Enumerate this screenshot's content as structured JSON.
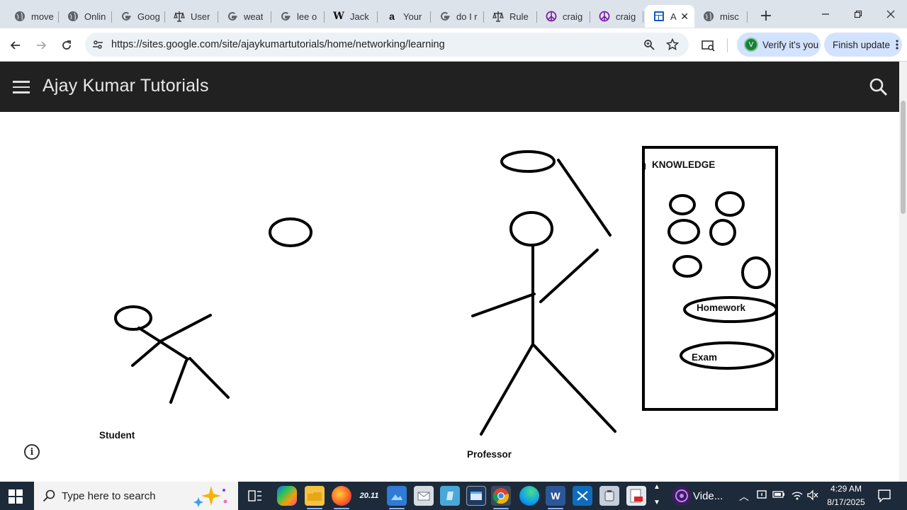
{
  "browser": {
    "tabs": [
      {
        "title": "move",
        "icon": "globe-icon"
      },
      {
        "title": "Onlin",
        "icon": "globe-icon"
      },
      {
        "title": "Goog",
        "icon": "google-icon"
      },
      {
        "title": "User",
        "icon": "scales-icon"
      },
      {
        "title": "weat",
        "icon": "google-icon"
      },
      {
        "title": "lee o",
        "icon": "google-icon"
      },
      {
        "title": "Jack",
        "icon": "wikipedia-icon"
      },
      {
        "title": "Your",
        "icon": "amazon-icon"
      },
      {
        "title": "do I r",
        "icon": "google-icon"
      },
      {
        "title": "Rule",
        "icon": "scales-icon"
      },
      {
        "title": "craig",
        "icon": "peace-icon"
      },
      {
        "title": "craig",
        "icon": "peace-icon"
      },
      {
        "title": "A",
        "icon": "sites-icon",
        "active": true
      },
      {
        "title": "misc",
        "icon": "globe-icon"
      }
    ],
    "url": "https://sites.google.com/site/ajaykumartutorials/home/networking/learning",
    "verify_label": "Verify it's you",
    "verify_avatar": "V",
    "finish_update_label": "Finish update",
    "new_tab_symbol": "+"
  },
  "site": {
    "title": "Ajay Kumar Tutorials",
    "header_bg": "#212121"
  },
  "drawing": {
    "knowledge_label": "KNOWLEDGE",
    "homework_label": "Homework",
    "exam_label": "Exam",
    "student_label": "Student",
    "professor_label": "Professor"
  },
  "taskbar": {
    "search_placeholder": "Type here to search",
    "widget_label": "20.11",
    "video_label": "Vide...",
    "time": "4:29 AM",
    "date": "8/17/2025",
    "bg_color": "#1c2a3a"
  }
}
